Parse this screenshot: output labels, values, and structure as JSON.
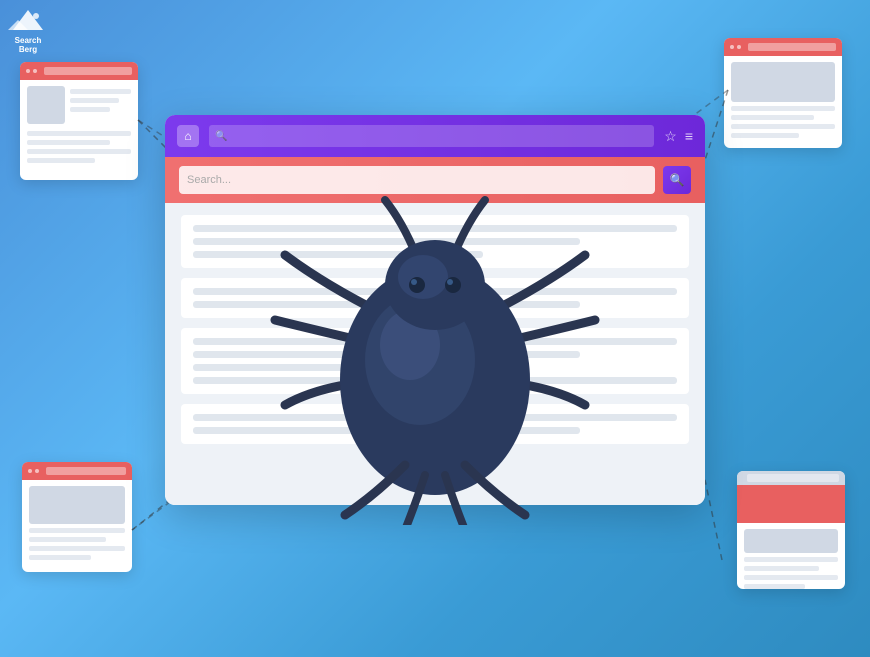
{
  "logo": {
    "text_line1": "Search",
    "text_line2": "Berg"
  },
  "browser": {
    "search_placeholder": "Search...",
    "nav_icons": [
      "⌂",
      "☆",
      "≡"
    ],
    "content_lines": [
      {
        "width": "100%"
      },
      {
        "width": "80%"
      },
      {
        "width": "60%"
      }
    ]
  },
  "cards": [
    {
      "position": "top-left"
    },
    {
      "position": "top-right"
    },
    {
      "position": "bottom-left"
    },
    {
      "position": "bottom-right"
    }
  ],
  "bug": {
    "description": "dark blue bug/tick creature"
  }
}
